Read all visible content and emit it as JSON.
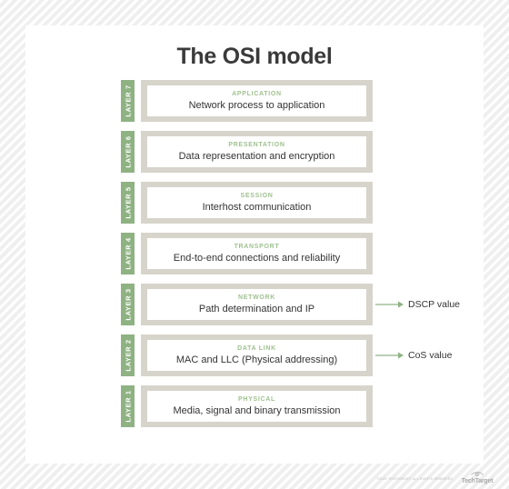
{
  "title": "The OSI model",
  "colors": {
    "tab_green": "#8fb283",
    "caption_green": "#9fc18f",
    "frame_gray": "#d7d4cb",
    "text_dark": "#333333",
    "title_dark": "#3a3a3a",
    "arrow_green": "#8fb283",
    "page_background": "#f2f2f2",
    "card_background": "#ffffff"
  },
  "layers": [
    {
      "tab": "LAYER 7",
      "caption": "APPLICATION",
      "description": "Network process to application",
      "callout": null
    },
    {
      "tab": "LAYER 6",
      "caption": "PRESENTATION",
      "description": "Data representation and encryption",
      "callout": null
    },
    {
      "tab": "LAYER 5",
      "caption": "SESSION",
      "description": "Interhost communication",
      "callout": null
    },
    {
      "tab": "LAYER 4",
      "caption": "TRANSPORT",
      "description": "End-to-end connections and reliability",
      "callout": null
    },
    {
      "tab": "LAYER 3",
      "caption": "NETWORK",
      "description": "Path determination and IP",
      "callout": "DSCP value"
    },
    {
      "tab": "LAYER 2",
      "caption": "DATA LINK",
      "description": "MAC and LLC (Physical addressing)",
      "callout": "CoS value"
    },
    {
      "tab": "LAYER 1",
      "caption": "PHYSICAL",
      "description": "Media, signal and binary transmission",
      "callout": null
    }
  ],
  "footer": {
    "copyright": "©2021 TECHTARGET, ALL RIGHTS RESERVED",
    "logo_text": "TechTarget"
  }
}
